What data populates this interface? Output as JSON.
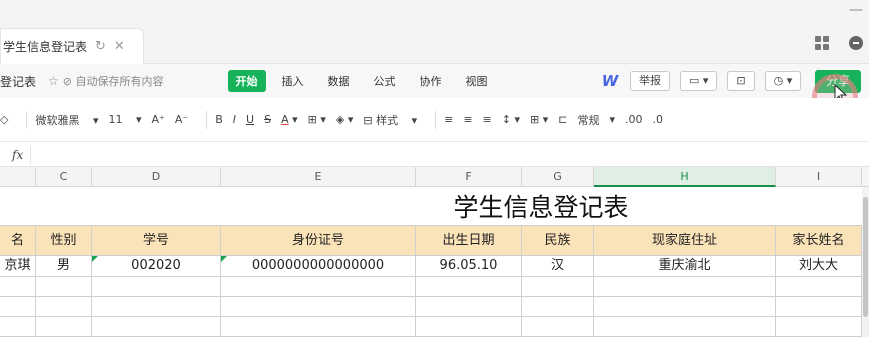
{
  "tab": {
    "title": "学生信息登记表"
  },
  "menubar": {
    "file_name": "登记表",
    "autosave": "自动保存所有内容",
    "items": [
      "开始",
      "插入",
      "数据",
      "公式",
      "协作",
      "视图"
    ],
    "report": "举报",
    "share": "分享"
  },
  "toolbar": {
    "font": "微软雅黑",
    "size": "11",
    "styles": "样式",
    "format": "常规"
  },
  "formula": {
    "fx": "fx"
  },
  "columns": [
    "C",
    "D",
    "E",
    "F",
    "G",
    "H",
    "I"
  ],
  "selected_column": "H",
  "sheet": {
    "title": "学生信息登记表",
    "headers": [
      "名",
      "性别",
      "学号",
      "身份证号",
      "出生日期",
      "民族",
      "现家庭住址",
      "家长姓名"
    ],
    "rows": [
      [
        "京琪",
        "男",
        "002020",
        "0000000000000000",
        "96.05.10",
        "汉",
        "重庆渝北",
        "刘大大"
      ]
    ]
  },
  "colors": {
    "accent": "#16b35a",
    "header_fill": "#fbe3b9"
  }
}
